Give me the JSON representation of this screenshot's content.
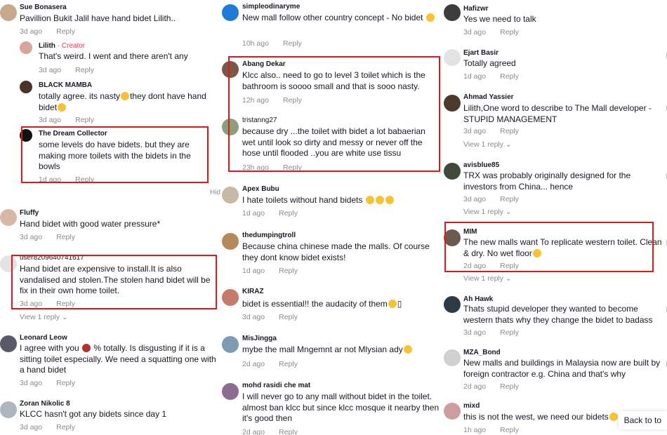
{
  "reply_label": "Reply",
  "column1": [
    {
      "name": "Sue Bonasera",
      "text": "Pavillion Bukit Jalil have hand bidet Lilith..",
      "age": "3d ago"
    },
    {
      "name": "Lilith",
      "badge": "· Creator",
      "text": "That's weird. I went and there aren't any",
      "age": "3d ago"
    },
    {
      "name": "BLACK MAMBA",
      "text": "totally agree. its nasty😁they dont have hand bidet🙄",
      "age": "3d ago"
    },
    {
      "name": "The Dream Collector",
      "text": "some levels do have bidets. but they are making more toilets with the bidets in the bowls",
      "age": "1d ago"
    },
    {
      "name": "Fluffy",
      "text": "Hand bidet with good water pressure*",
      "age": "3d ago"
    },
    {
      "name": "user8209640741617",
      "text": "Hand bidet are expensive to install.It is also vandalised and stolen.The stolen hand bidet will be fix in their own home toilet.",
      "age": "3d ago",
      "view": "View 1 reply"
    },
    {
      "name": "Leonard Leow",
      "text": "I agree with you 💯 % totally. Is disgusting if it is a sitting toilet especially. We need a squatting one with a hand bidet",
      "age": "3d ago"
    },
    {
      "name": "Zoran Nikolic 8",
      "text": "KLCC hasn't got any bidets since day 1",
      "age": "3d ago"
    }
  ],
  "hidden_label": "Hid",
  "column2": [
    {
      "name": "simpleodinaryme",
      "text": "New mall follow other country concept - No bidet 😁",
      "age": "10h ago"
    },
    {
      "name": "Abang Dekar",
      "text": "Klcc also.. need to go to level 3 toilet which is the bathroom is soooo small and that is sooo nasty.",
      "age": "12h ago"
    },
    {
      "name": "tristanng27",
      "text": "because dry ...the toilet with bidet a lot babaerian wet until look so dirty and messy or never off the hose until flooded ..you are white use tissu",
      "age": "23h ago"
    },
    {
      "name": "Apex Bubu",
      "text": "I hate toilets without hand bidets 😭😭😭",
      "age": "1d ago"
    },
    {
      "name": "thedumpingtroll",
      "text": "Because china chinese made the malls. Of course they dont know bidet exists!",
      "age": "1d ago"
    },
    {
      "name": "KIRAZ",
      "text": "bidet is essential!! the audacity of them😂▯",
      "age": "3d ago"
    },
    {
      "name": "MisJingga",
      "text": "mybe the mall Mngemnt ar not Mlysian ady😅",
      "age": "2d ago"
    },
    {
      "name": "mohd rasidi che mat",
      "text": "I will never go to any mall without bidet in the toilet. almost ban klcc but since klcc mosque it nearby then it's good then",
      "age": "2d ago"
    }
  ],
  "column3": [
    {
      "name": "Hafizwr",
      "text": "Yes we need to talk",
      "age": "3d ago"
    },
    {
      "name": "Ejart Basir",
      "text": "Totally agreed",
      "age": "1d ago"
    },
    {
      "name": "Ahmad Yassier",
      "text": "Lilith,One word to describe to The Mall developer - STUPID MANAGEMENT",
      "age": "3d ago",
      "view": "View 1 reply"
    },
    {
      "name": "avisblue85",
      "text": "TRX was probably originally designed for the investors from China... hence",
      "age": "3d ago",
      "view": "View 1 reply"
    },
    {
      "name": "MIM",
      "text": "The new malls want To replicate western toilet. Clean & dry. No wet floor😅",
      "age": "2d ago",
      "view": "View 1 reply"
    },
    {
      "name": "Ah Hawk",
      "text": "Thats stupid developer they wanted to become western thats why they change the bidet to badass",
      "age": "3d ago"
    },
    {
      "name": "MZA_Bond",
      "text": "New malls and buildings in Malaysia now are built by foreign contractor e.g. China and that's why",
      "age": "2d ago"
    },
    {
      "name": "mixd",
      "text": "this is not the west, we need our bidets🙁",
      "age": "1h ago"
    }
  ],
  "back_to_top": "Back to to"
}
